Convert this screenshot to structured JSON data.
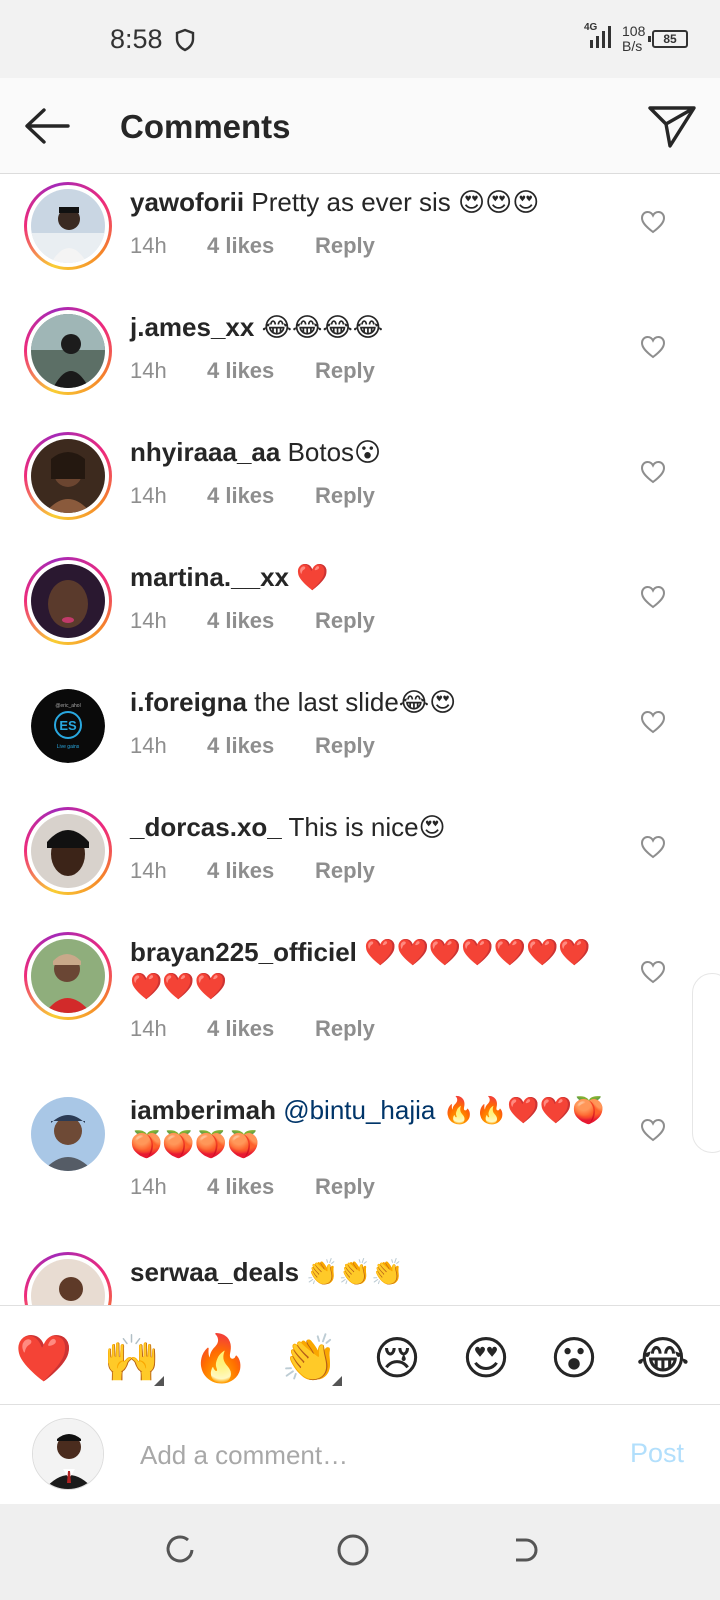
{
  "status_bar": {
    "time": "8:58",
    "network": "4G",
    "speed_value": "108",
    "speed_unit": "B/s",
    "battery": "85"
  },
  "header": {
    "title": "Comments"
  },
  "comments": [
    {
      "username": "yawoforii",
      "text": "Pretty as ever sis 😍😍😍",
      "time": "14h",
      "likes": "4 likes",
      "reply": "Reply",
      "ring": true
    },
    {
      "username": "j.ames_xx",
      "text": "😂😂😂😂",
      "time": "14h",
      "likes": "4 likes",
      "reply": "Reply",
      "ring": true
    },
    {
      "username": "nhyiraaa_aa",
      "text": "Botos😮",
      "time": "14h",
      "likes": "4 likes",
      "reply": "Reply",
      "ring": true
    },
    {
      "username": "martina.__xx",
      "text": "❤️",
      "time": "14h",
      "likes": "4 likes",
      "reply": "Reply",
      "ring": true
    },
    {
      "username": "i.foreigna",
      "text": "the last slide😂😍",
      "time": "14h",
      "likes": "4 likes",
      "reply": "Reply",
      "ring": false
    },
    {
      "username": "_dorcas.xo_",
      "text": "This is nice😍",
      "time": "14h",
      "likes": "4 likes",
      "reply": "Reply",
      "ring": true
    },
    {
      "username": "brayan225_officiel",
      "text": "❤️❤️❤️❤️❤️❤️❤️❤️❤️❤️",
      "time": "14h",
      "likes": "4 likes",
      "reply": "Reply",
      "ring": true
    },
    {
      "username": "iamberimah",
      "mention": "@bintu_hajia",
      "text": "🔥🔥❤️❤️🍑🍑🍑🍑🍑",
      "time": "14h",
      "likes": "4 likes",
      "reply": "Reply",
      "ring": false
    },
    {
      "username": "serwaa_deals",
      "text": "👏👏👏",
      "time": "",
      "likes": "",
      "reply": "",
      "ring": true
    }
  ],
  "avatar_badge": {
    "handle": "@eric_ahol",
    "initials": "ES",
    "caption": "Live gains"
  },
  "quick_emojis": [
    "❤️",
    "🙌",
    "🔥",
    "👏",
    "😢",
    "😍",
    "😮",
    "😂"
  ],
  "composer": {
    "placeholder": "Add a comment…",
    "post_label": "Post"
  },
  "colors": {
    "accent_blue": "#0095f6",
    "post_disabled": "#b2dffc",
    "meta_gray": "#8e8e8e"
  }
}
